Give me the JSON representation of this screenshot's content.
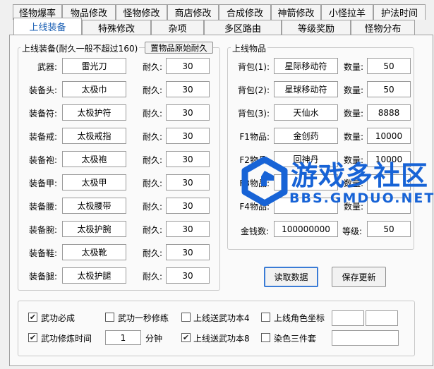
{
  "tabs_row1": [
    "怪物爆率",
    "物品修改",
    "怪物修改",
    "商店修改",
    "合成修改",
    "神箭修改",
    "小怪拉羊",
    "护法时间"
  ],
  "tabs_row2": [
    "上线装备",
    "特殊修改",
    "杂项",
    "多区路由",
    "等级奖励",
    "怪物分布"
  ],
  "equip_group": {
    "title": "上线装备(耐久一般不超过160)",
    "reset_button": "置物品原始耐久",
    "durability_label": "耐久:",
    "rows": [
      {
        "label": "武器:",
        "item": "雷光刀",
        "dur": "30"
      },
      {
        "label": "装备头:",
        "item": "太极巾",
        "dur": "30"
      },
      {
        "label": "装备符:",
        "item": "太极护符",
        "dur": "30"
      },
      {
        "label": "装备戒:",
        "item": "太极戒指",
        "dur": "30"
      },
      {
        "label": "装备袍:",
        "item": "太极袍",
        "dur": "30"
      },
      {
        "label": "装备甲:",
        "item": "太极甲",
        "dur": "30"
      },
      {
        "label": "装备腰:",
        "item": "太极腰带",
        "dur": "30"
      },
      {
        "label": "装备腕:",
        "item": "太极护腕",
        "dur": "30"
      },
      {
        "label": "装备鞋:",
        "item": "太极靴",
        "dur": "30"
      },
      {
        "label": "装备腿:",
        "item": "太极护腿",
        "dur": "30"
      }
    ]
  },
  "items_group": {
    "title": "上线物品",
    "qty_label": "数量:",
    "rows": [
      {
        "label": "背包(1):",
        "item": "星际移动符",
        "qty": "50"
      },
      {
        "label": "背包(2):",
        "item": "星球移动符",
        "qty": "50"
      },
      {
        "label": "背包(3):",
        "item": "天仙水",
        "qty": "8888"
      },
      {
        "label": "F1物品:",
        "item": "金创药",
        "qty": "10000"
      },
      {
        "label": "F2物品:",
        "item": "回神丹",
        "qty": "10000"
      },
      {
        "label": "F3物品:",
        "item": "",
        "qty": ""
      },
      {
        "label": "F4物品:",
        "item": "",
        "qty": ""
      }
    ],
    "money_label": "金钱数:",
    "money": "100000000",
    "level_label": "等级:",
    "level": "50"
  },
  "buttons": {
    "read": "读取数据",
    "save": "保存更新"
  },
  "options": {
    "martial_must_succeed": {
      "label": "武功必成",
      "checked": true
    },
    "martial_one_sec": {
      "label": "武功一秒修练",
      "checked": false
    },
    "online_martial_4": {
      "label": "上线送武功本4",
      "checked": false
    },
    "online_role_coords": {
      "label": "上线角色坐标",
      "checked": false
    },
    "martial_train_time": {
      "label": "武功修炼时间",
      "checked": true
    },
    "train_minutes": "1",
    "minutes_unit": "分钟",
    "online_martial_8": {
      "label": "上线送武功本8",
      "checked": true
    },
    "dye_three_set": {
      "label": "染色三件套",
      "checked": false
    }
  },
  "watermark": {
    "brand": "游戏多社区",
    "site": "BBS.GMDUO.NET"
  },
  "colors": {
    "accent": "#1a5fb4",
    "watermark": "#1763d6"
  }
}
